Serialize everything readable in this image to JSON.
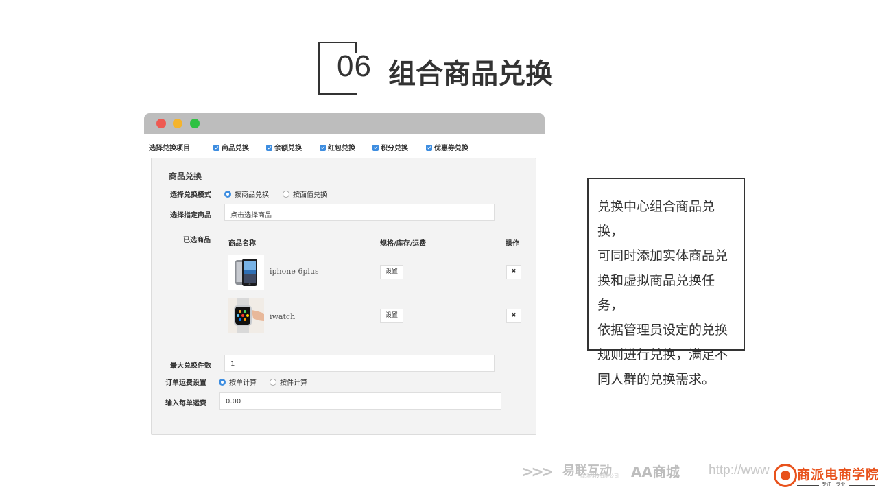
{
  "slide": {
    "number": "06",
    "title": "组合商品兑换"
  },
  "window_controls": {
    "close_color": "#ee5a52",
    "minimize_color": "#f4b42d",
    "maximize_color": "#2fc143"
  },
  "exchange_types": {
    "label": "选择兑换项目",
    "options": [
      {
        "label": "商品兑换",
        "checked": true
      },
      {
        "label": "余额兑换",
        "checked": true
      },
      {
        "label": "红包兑换",
        "checked": true
      },
      {
        "label": "积分兑换",
        "checked": true
      },
      {
        "label": "优惠券兑换",
        "checked": true
      }
    ]
  },
  "panel": {
    "title": "商品兑换",
    "mode": {
      "label": "选择兑换模式",
      "options": [
        {
          "label": "按商品兑换",
          "selected": true
        },
        {
          "label": "按面值兑换",
          "selected": false
        }
      ]
    },
    "select_product": {
      "label": "选择指定商品",
      "placeholder": "点击选择商品"
    },
    "selected_products": {
      "label": "已选商品",
      "columns": [
        "商品名称",
        "规格/库存/运费",
        "操作"
      ],
      "rows": [
        {
          "name": "iphone 6plus",
          "set_label": "设置",
          "delete_label": "✖"
        },
        {
          "name": "iwatch",
          "set_label": "设置",
          "delete_label": "✖"
        }
      ]
    },
    "max_count": {
      "label": "最大兑换件数",
      "value": "1"
    },
    "shipping": {
      "label": "订单运费设置",
      "options": [
        {
          "label": "按单计算",
          "selected": true
        },
        {
          "label": "按件计算",
          "selected": false
        }
      ]
    },
    "shipping_fee": {
      "label": "输入每单运费",
      "value": "0.00"
    }
  },
  "description": {
    "lines": [
      "兑换中心组合商品兑换，",
      "可同时添加实体商品兑",
      "换和虚拟商品兑换任务，",
      "依据管理员设定的兑换",
      "规则进行兑换，满足不",
      "同人群的兑换需求。"
    ]
  },
  "footer": {
    "chevrons": ">>>",
    "logo1": "易联互动",
    "logo1_sub": "商场科技有限公司",
    "logo2": "AA商城",
    "url": "http://www",
    "brand_name": "商派电商学院",
    "brand_slogan": "专注 · 专业",
    "brand_color": "#e8521c"
  }
}
